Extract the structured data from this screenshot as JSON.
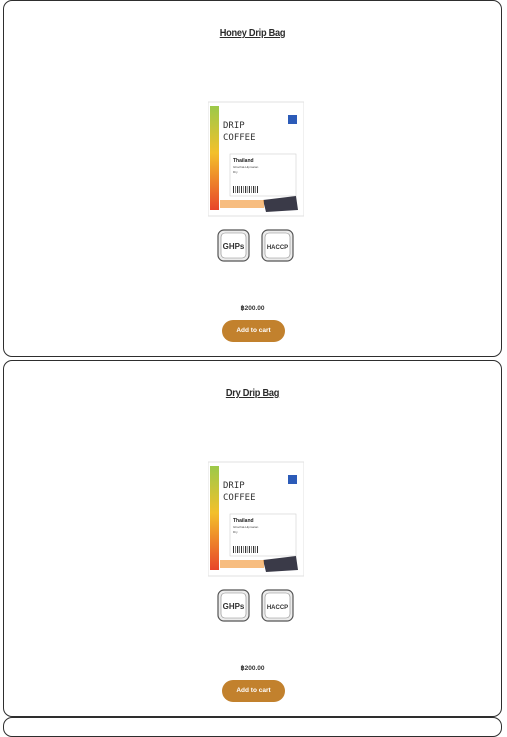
{
  "products": [
    {
      "title": "Honey Drip Bag",
      "price": "฿200.00",
      "button_label": "Add to cart",
      "package": {
        "line1": "DRIP",
        "line2": "COFFEE",
        "origin": "Thailand",
        "farm": "Ghochat-Hipmaran",
        "process": "Dry"
      },
      "badges": [
        "GHPs",
        "HACCP"
      ]
    },
    {
      "title": "Dry Drip Bag",
      "price": "฿200.00",
      "button_label": "Add to cart",
      "package": {
        "line1": "DRIP",
        "line2": "COFFEE",
        "origin": "Thailand",
        "farm": "Ghochat-Hipmaran",
        "process": "Dry"
      },
      "badges": [
        "GHPs",
        "HACCP"
      ]
    }
  ],
  "colors": {
    "button": "#c2812d",
    "border": "#2e2e2e"
  }
}
